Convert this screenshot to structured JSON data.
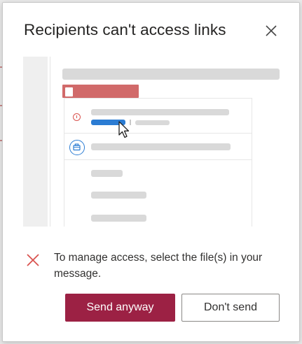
{
  "dialog": {
    "title": "Recipients can't access links",
    "close_icon": "close-icon",
    "message": "To manage access, select the file(s) in your message.",
    "message_icon": "red-x-icon",
    "primary_button": "Send anyway",
    "secondary_button": "Don't send"
  },
  "illustration": {
    "icons": [
      "document-icon",
      "info-icon",
      "briefcase-icon",
      "mouse-cursor-icon"
    ]
  },
  "colors": {
    "primary": "#9c2144",
    "error": "#d9534f",
    "accent": "#2b7cd3",
    "placeholder_bar": "#d9d9d9",
    "highlight_bar": "#d16a6a"
  }
}
